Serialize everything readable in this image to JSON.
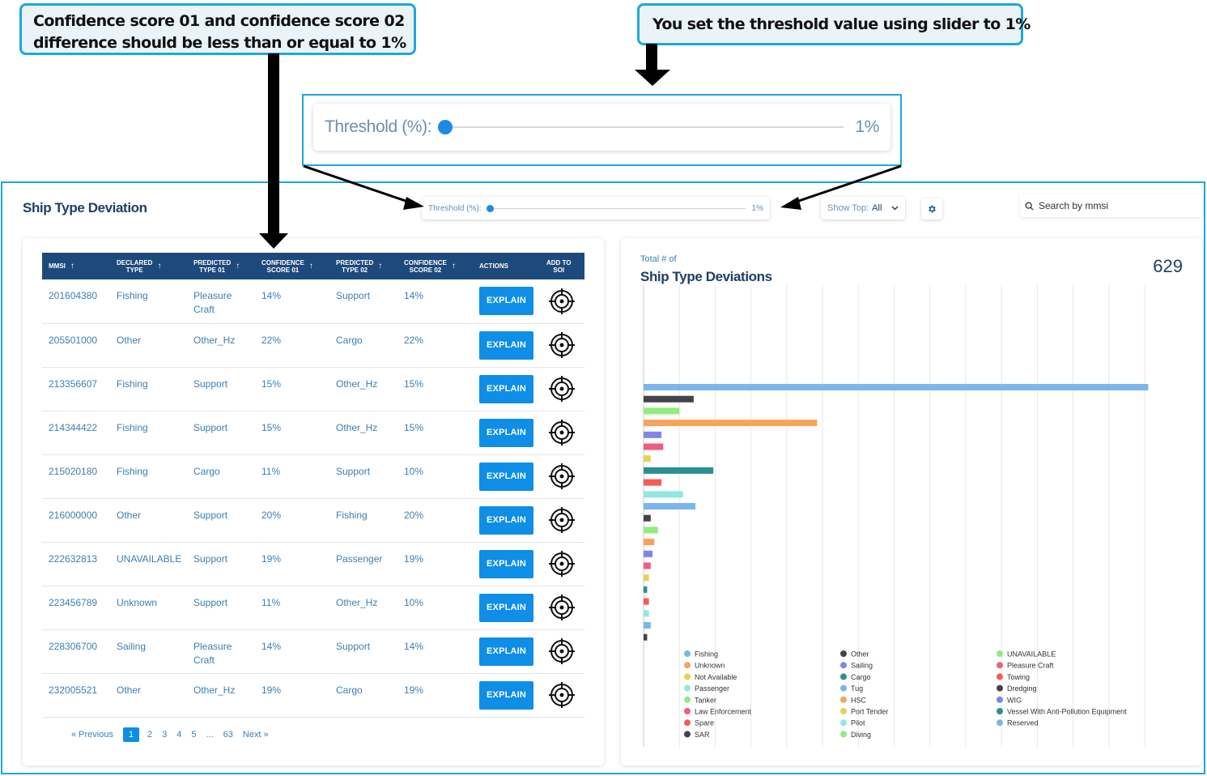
{
  "callouts": {
    "left_line1": "Confidence score 01 and confidence score 02",
    "left_line2": "difference  should be less than or equal to 1%",
    "right": "You set the threshold value using slider to 1%"
  },
  "threshold": {
    "label": "Threshold (%):",
    "value_text": "1%",
    "value": 1
  },
  "page": {
    "title": "Ship Type Deviation"
  },
  "show_top": {
    "label": "Show Top:",
    "selected": "All"
  },
  "search": {
    "placeholder": "Search by mmsi"
  },
  "table": {
    "columns": [
      "MMSI",
      "DECLARED TYPE",
      "PREDICTED TYPE 01",
      "CONFIDENCE SCORE 01",
      "PREDICTED TYPE 02",
      "CONFIDENCE SCORE 02",
      "ACTIONS",
      "ADD TO SOI"
    ],
    "column_lines": [
      [
        "MMSI"
      ],
      [
        "DECLARED",
        "TYPE"
      ],
      [
        "PREDICTED",
        "TYPE 01"
      ],
      [
        "CONFIDENCE",
        "SCORE 01"
      ],
      [
        "PREDICTED",
        "TYPE 02"
      ],
      [
        "CONFIDENCE",
        "SCORE 02"
      ],
      [
        "ACTIONS"
      ],
      [
        "ADD TO",
        "SOI"
      ]
    ],
    "explain_label": "EXPLAIN",
    "rows": [
      {
        "mmsi": "201604380",
        "declared": "Fishing",
        "pred1": "Pleasure Craft",
        "score1": "14%",
        "pred2": "Support",
        "score2": "14%"
      },
      {
        "mmsi": "205501000",
        "declared": "Other",
        "pred1": "Other_Hz",
        "score1": "22%",
        "pred2": "Cargo",
        "score2": "22%"
      },
      {
        "mmsi": "213356607",
        "declared": "Fishing",
        "pred1": "Support",
        "score1": "15%",
        "pred2": "Other_Hz",
        "score2": "15%"
      },
      {
        "mmsi": "214344422",
        "declared": "Fishing",
        "pred1": "Support",
        "score1": "15%",
        "pred2": "Other_Hz",
        "score2": "15%"
      },
      {
        "mmsi": "215020180",
        "declared": "Fishing",
        "pred1": "Cargo",
        "score1": "11%",
        "pred2": "Support",
        "score2": "10%"
      },
      {
        "mmsi": "216000000",
        "declared": "Other",
        "pred1": "Support",
        "score1": "20%",
        "pred2": "Fishing",
        "score2": "20%"
      },
      {
        "mmsi": "222632813",
        "declared": "UNAVAILABLE",
        "pred1": "Support",
        "score1": "19%",
        "pred2": "Passenger",
        "score2": "19%"
      },
      {
        "mmsi": "223456789",
        "declared": "Unknown",
        "pred1": "Support",
        "score1": "11%",
        "pred2": "Other_Hz",
        "score2": "10%"
      },
      {
        "mmsi": "228306700",
        "declared": "Sailing",
        "pred1": "Pleasure Craft",
        "score1": "14%",
        "pred2": "Support",
        "score2": "14%"
      },
      {
        "mmsi": "232005521",
        "declared": "Other",
        "pred1": "Other_Hz",
        "score1": "19%",
        "pred2": "Cargo",
        "score2": "19%"
      }
    ]
  },
  "pagination": {
    "previous": "« Previous",
    "pages": [
      "1",
      "2",
      "3",
      "4",
      "5",
      "...",
      "63"
    ],
    "active": "1",
    "next": "Next »"
  },
  "summary": {
    "total_label": "Total # of",
    "total_value": "629",
    "title": "Ship Type Deviations"
  },
  "chart_data": {
    "type": "bar",
    "orientation": "horizontal",
    "categories": [
      "Fishing",
      "Other",
      "UNAVAILABLE",
      "Unknown",
      "Sailing",
      "Pleasure Craft",
      "Not Available",
      "Cargo",
      "Towing",
      "Passenger",
      "Tug",
      "Dredging",
      "Tanker",
      "HSC",
      "WIG",
      "Law Enforcement",
      "Port Tender",
      "Vessel With Anti-Pollution Equipment",
      "Spare",
      "Pilot",
      "Reserved",
      "SAR",
      "Diving"
    ],
    "values": [
      282,
      28,
      20,
      97,
      10,
      11,
      4,
      39,
      10,
      22,
      29,
      4,
      8,
      6,
      5,
      4,
      3,
      2,
      3,
      3,
      4,
      2,
      0
    ],
    "colors": [
      "#7cb5ec",
      "#434348",
      "#90ed7d",
      "#f7a35c",
      "#8085e9",
      "#f15c80",
      "#e4d354",
      "#2b908f",
      "#f45b5b",
      "#91e8e1",
      "#7cb5ec",
      "#434348",
      "#90ed7d",
      "#f7a35c",
      "#8085e9",
      "#f15c80",
      "#e4d354",
      "#2b908f",
      "#f45b5b",
      "#91e8e1",
      "#7cb5ec",
      "#434348",
      "#90ed7d"
    ],
    "legend_columns": [
      [
        "Fishing",
        "Unknown",
        "Not Available",
        "Passenger",
        "Tanker",
        "Law Enforcement",
        "Spare",
        "SAR"
      ],
      [
        "Other",
        "Sailing",
        "Cargo",
        "Tug",
        "HSC",
        "Port Tender",
        "Pilot",
        "Diving"
      ],
      [
        "UNAVAILABLE",
        "Pleasure Craft",
        "Towing",
        "Dredging",
        "WIG",
        "Vessel With Anti-Pollution Equipment",
        "Reserved"
      ]
    ],
    "xlim": [
      0,
      280
    ],
    "grid": true,
    "legend_position": "bottom"
  }
}
